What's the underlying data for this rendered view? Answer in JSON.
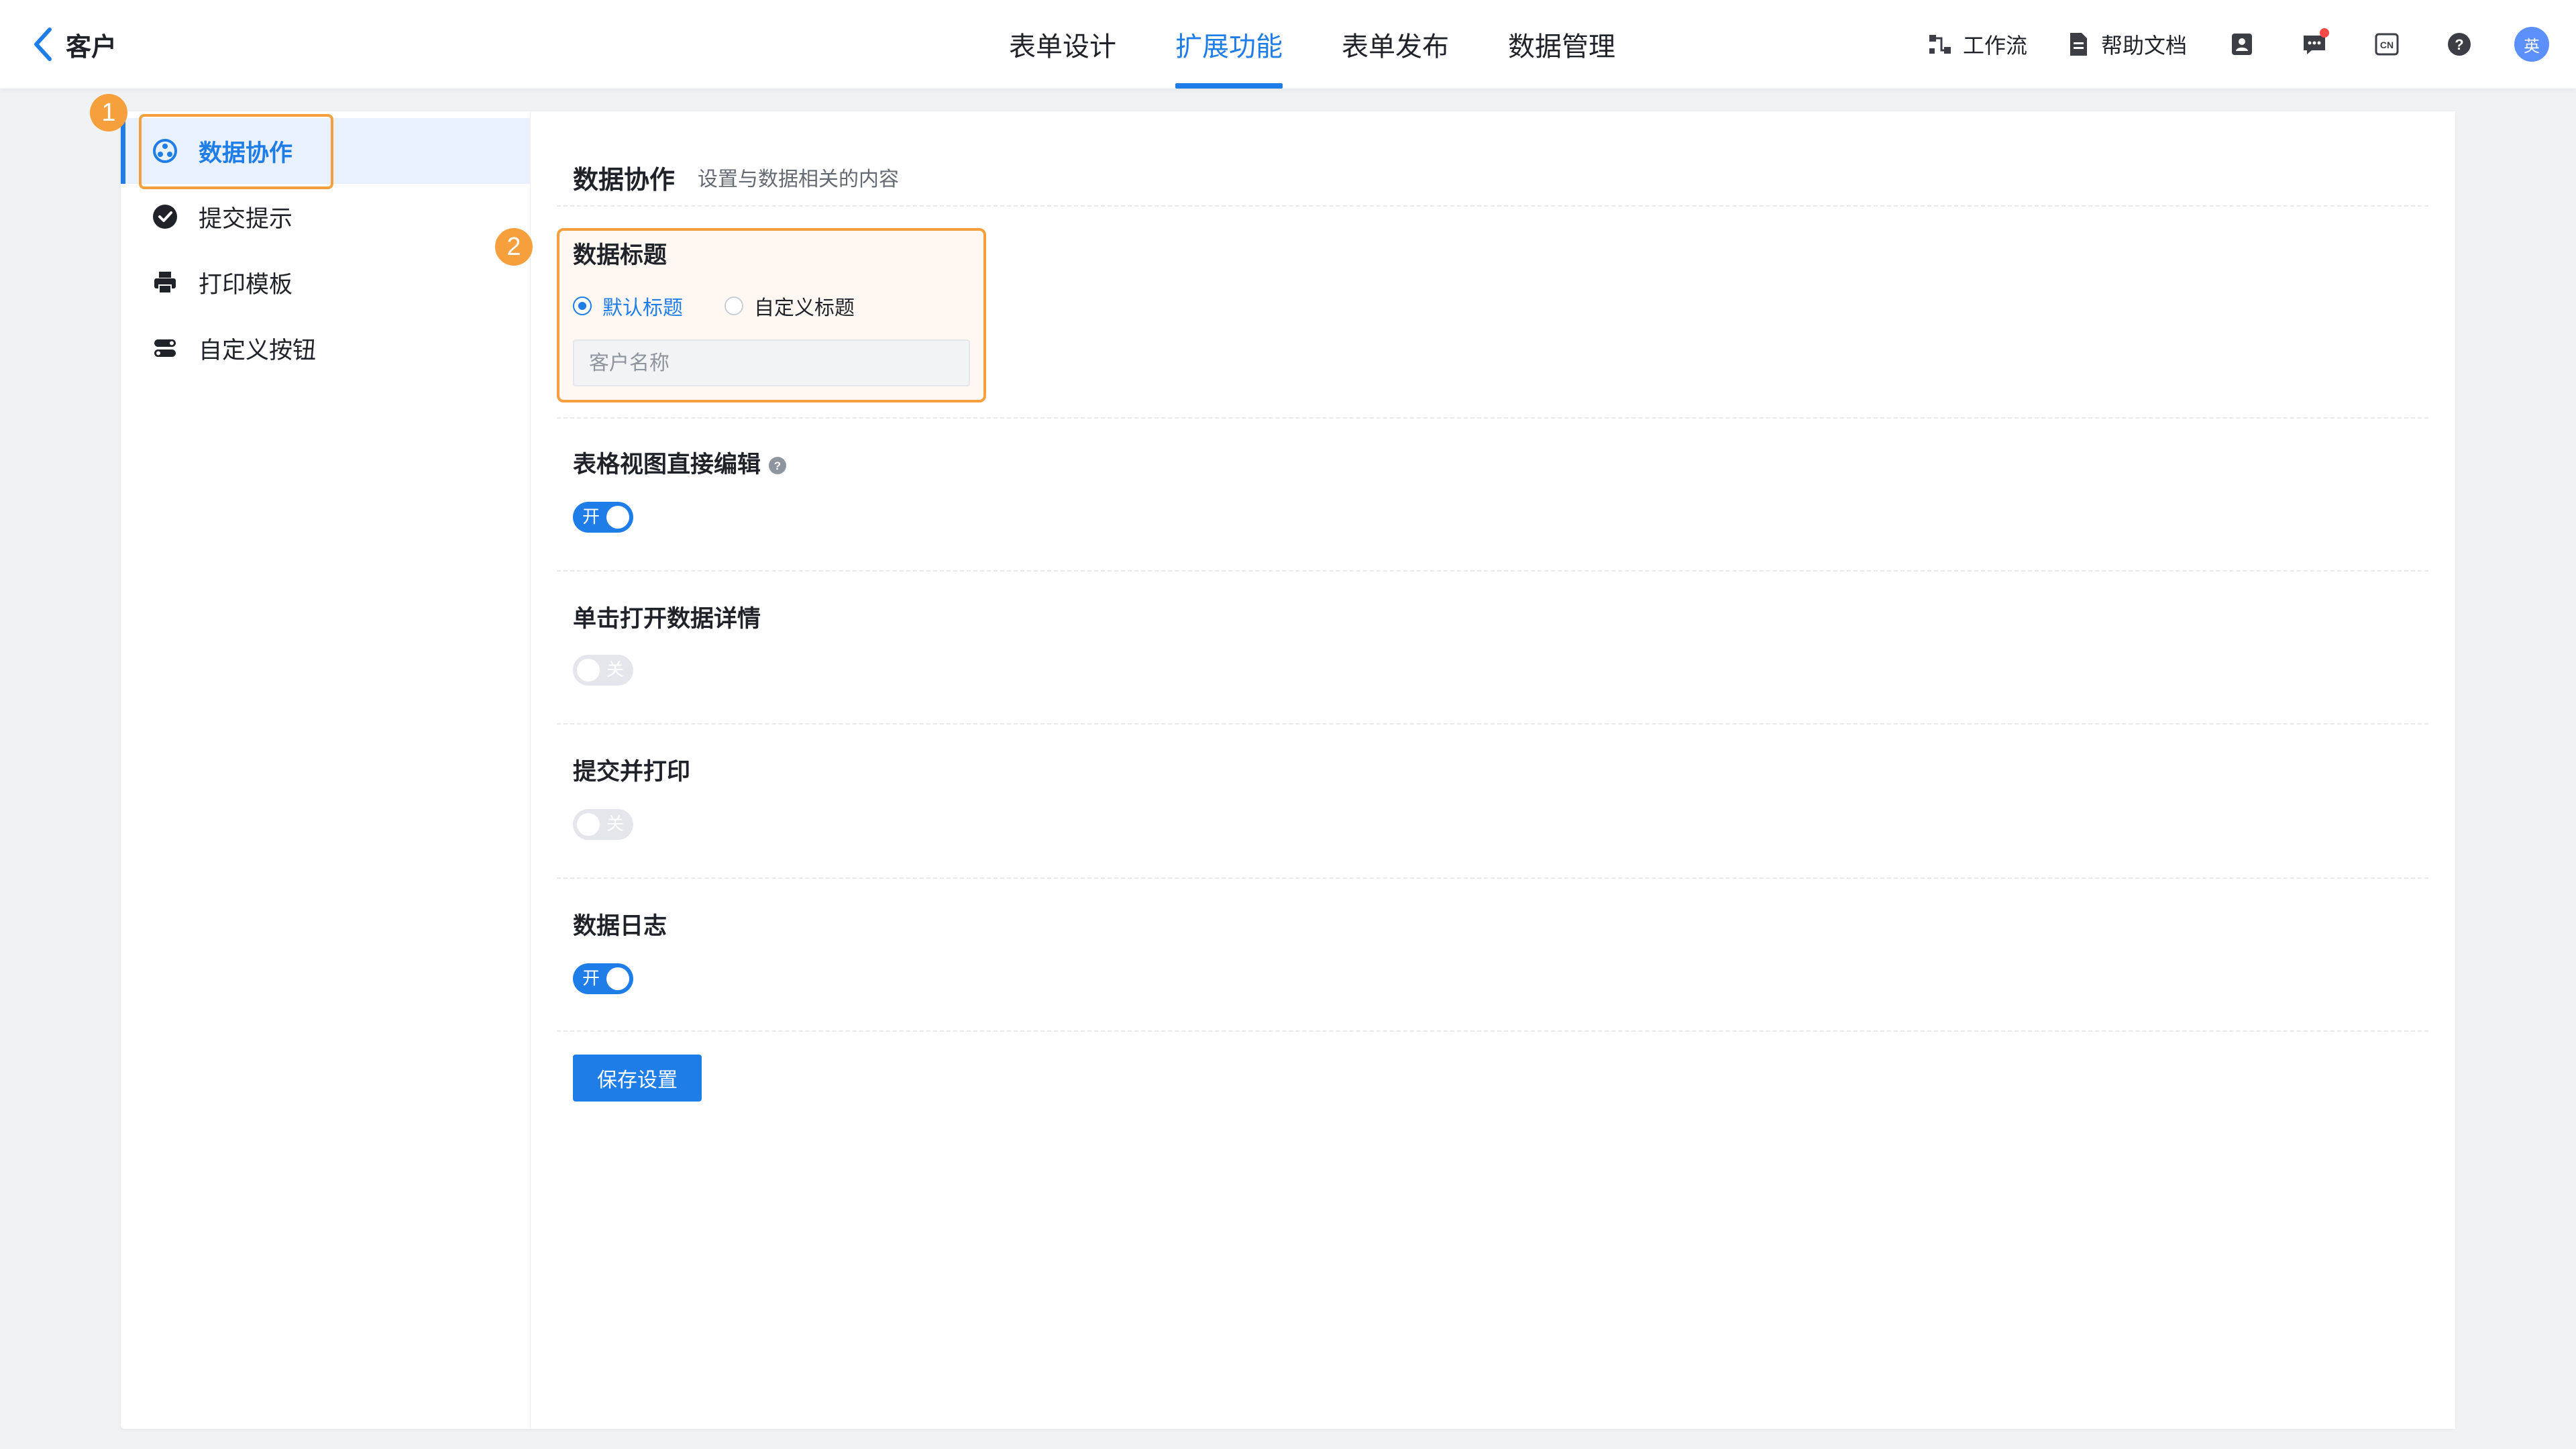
{
  "header": {
    "back_label": "客户",
    "tabs": [
      {
        "label": "表单设计",
        "active": false
      },
      {
        "label": "扩展功能",
        "active": true
      },
      {
        "label": "表单发布",
        "active": false
      },
      {
        "label": "数据管理",
        "active": false
      }
    ],
    "tools": {
      "workflow_label": "工作流",
      "help_docs_label": "帮助文档",
      "avatar_text": "英"
    }
  },
  "sidebar": {
    "items": [
      {
        "label": "数据协作",
        "icon": "data-collab-icon",
        "active": true
      },
      {
        "label": "提交提示",
        "icon": "check-circle-icon",
        "active": false
      },
      {
        "label": "打印模板",
        "icon": "printer-icon",
        "active": false
      },
      {
        "label": "自定义按钮",
        "icon": "custom-button-icon",
        "active": false
      }
    ]
  },
  "badges": {
    "one": "1",
    "two": "2"
  },
  "content": {
    "title": "数据协作",
    "subtitle": "设置与数据相关的内容",
    "data_title": {
      "label": "数据标题",
      "options": [
        {
          "label": "默认标题",
          "checked": true
        },
        {
          "label": "自定义标题",
          "checked": false
        }
      ],
      "placeholder": "客户名称"
    },
    "settings": [
      {
        "label": "表格视图直接编辑",
        "has_help": true,
        "on": true,
        "state_text": "开"
      },
      {
        "label": "单击打开数据详情",
        "has_help": false,
        "on": false,
        "state_text": "关"
      },
      {
        "label": "提交并打印",
        "has_help": false,
        "on": false,
        "state_text": "关"
      },
      {
        "label": "数据日志",
        "has_help": false,
        "on": true,
        "state_text": "开"
      }
    ],
    "save_label": "保存设置"
  },
  "colors": {
    "accent": "#1e7de6",
    "highlight": "#f5a03c",
    "notification": "#f54a45"
  }
}
